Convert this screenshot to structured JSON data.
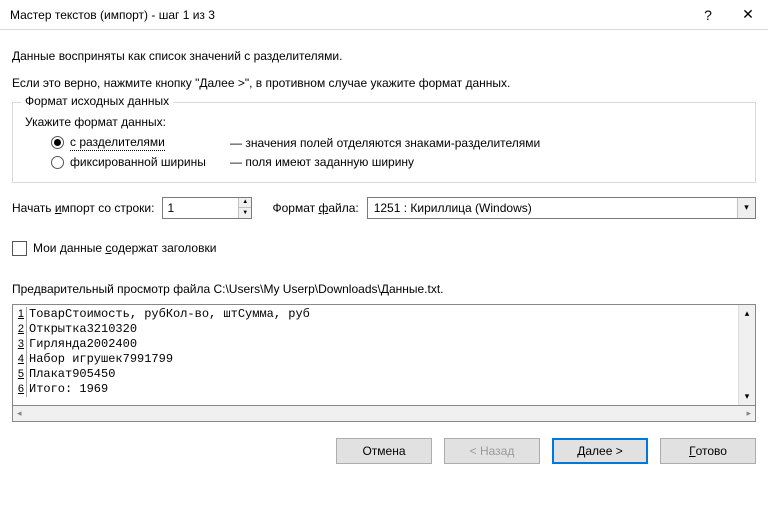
{
  "titlebar": {
    "title": "Мастер текстов (импорт) - шаг 1 из 3",
    "help": "?",
    "close": "✕"
  },
  "intro": {
    "line1": "Данные восприняты как список значений с разделителями.",
    "line2": "Если это верно, нажмите кнопку \"Далее >\", в противном случае укажите формат данных."
  },
  "format_group": {
    "legend": "Формат исходных данных",
    "prompt": "Укажите формат данных:",
    "delimited_label": "с разделителями",
    "delimited_desc": "— значения полей отделяются знаками-разделителями",
    "fixed_label": "фиксированной ширины",
    "fixed_desc": "— поля имеют заданную ширину"
  },
  "start_row": {
    "label_pre": "Начать ",
    "label_u": "и",
    "label_post": "мпорт со строки:",
    "value": "1"
  },
  "file_format": {
    "label_pre": "Формат ",
    "label_u": "ф",
    "label_post": "айла:",
    "value": "1251 : Кириллица (Windows)"
  },
  "headers_checkbox": {
    "label_pre": "Мои данные ",
    "label_u": "с",
    "label_post": "одержат заголовки"
  },
  "preview": {
    "label": "Предварительный просмотр файла C:\\Users\\My Userp\\Downloads\\Данные.txt.",
    "lines": [
      "ТоварСтоимость, рубКол-во, штСумма, руб",
      "Открытка3210320",
      "Гирлянда2002400",
      "Набор игрушек7991799",
      "Плакат905450",
      "Итого: 1969"
    ]
  },
  "buttons": {
    "cancel": "Отмена",
    "back": "< Назад",
    "next": "Далее >",
    "finish_u": "Г",
    "finish_post": "отово"
  }
}
